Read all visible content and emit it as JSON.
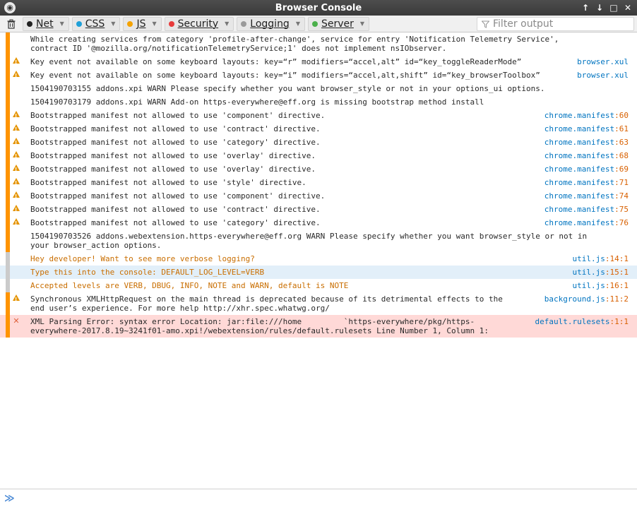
{
  "window": {
    "title": "Browser Console"
  },
  "titlebar": {
    "minimize_glyph": "↑",
    "restore_glyph": "↓",
    "max_glyph": "□",
    "close_glyph": "✕"
  },
  "toolbar": {
    "filters": [
      {
        "name": "Net",
        "color": "#222222"
      },
      {
        "name": "CSS",
        "color": "#1fa0d8"
      },
      {
        "name": "JS",
        "color": "#f5a300"
      },
      {
        "name": "Security",
        "color": "#e83b3b"
      },
      {
        "name": "Logging",
        "color": "#9a9a9a"
      },
      {
        "name": "Server",
        "color": "#4bb04b"
      }
    ],
    "filter_placeholder": "Filter output"
  },
  "messages": [
    {
      "type": "log",
      "lines": [
        "While creating services from category 'profile-after-change', service for entry 'Notification Telemetry Service',",
        "contract ID '@mozilla.org/notificationTelemetryService;1' does not implement nsIObserver."
      ],
      "source": "",
      "line": ""
    },
    {
      "type": "warn",
      "lines": [
        "Key event not available on some keyboard layouts: key=“r” modifiers=“accel,alt” id=“key_toggleReaderMode”"
      ],
      "source": "browser.xul",
      "line": ""
    },
    {
      "type": "warn",
      "lines": [
        "Key event not available on some keyboard layouts: key=“i” modifiers=“accel,alt,shift” id=“key_browserToolbox”"
      ],
      "source": "browser.xul",
      "line": ""
    },
    {
      "type": "log",
      "lines": [
        "1504190703155 addons.xpi WARN Please specify whether you want browser_style or not in your options_ui options."
      ],
      "source": "",
      "line": ""
    },
    {
      "type": "log",
      "lines": [
        "1504190703179 addons.xpi WARN Add-on https-everywhere@eff.org is missing bootstrap method install"
      ],
      "source": "",
      "line": ""
    },
    {
      "type": "warn",
      "lines": [
        "Bootstrapped manifest not allowed to use 'component' directive."
      ],
      "source": "chrome.manifest",
      "line": ":60"
    },
    {
      "type": "warn",
      "lines": [
        "Bootstrapped manifest not allowed to use 'contract' directive."
      ],
      "source": "chrome.manifest",
      "line": ":61"
    },
    {
      "type": "warn",
      "lines": [
        "Bootstrapped manifest not allowed to use 'category' directive."
      ],
      "source": "chrome.manifest",
      "line": ":63"
    },
    {
      "type": "warn",
      "lines": [
        "Bootstrapped manifest not allowed to use 'overlay' directive."
      ],
      "source": "chrome.manifest",
      "line": ":68"
    },
    {
      "type": "warn",
      "lines": [
        "Bootstrapped manifest not allowed to use 'overlay' directive."
      ],
      "source": "chrome.manifest",
      "line": ":69"
    },
    {
      "type": "warn",
      "lines": [
        "Bootstrapped manifest not allowed to use 'style' directive."
      ],
      "source": "chrome.manifest",
      "line": ":71"
    },
    {
      "type": "warn",
      "lines": [
        "Bootstrapped manifest not allowed to use 'component' directive."
      ],
      "source": "chrome.manifest",
      "line": ":74"
    },
    {
      "type": "warn",
      "lines": [
        "Bootstrapped manifest not allowed to use 'contract' directive."
      ],
      "source": "chrome.manifest",
      "line": ":75"
    },
    {
      "type": "warn",
      "lines": [
        "Bootstrapped manifest not allowed to use 'category' directive."
      ],
      "source": "chrome.manifest",
      "line": ":76"
    },
    {
      "type": "log",
      "lines": [
        "1504190703526 addons.webextension.https-everywhere@eff.org WARN Please specify whether you want browser_style or not in",
        "your browser_action options."
      ],
      "source": "",
      "line": ""
    },
    {
      "type": "logo",
      "lines": [
        "Hey developer! Want to see more verbose logging?"
      ],
      "source": "util.js",
      "line": ":14:1"
    },
    {
      "type": "logo-hl",
      "lines": [
        "Type this into the console: DEFAULT_LOG_LEVEL=VERB"
      ],
      "source": "util.js",
      "line": ":15:1"
    },
    {
      "type": "logo",
      "lines": [
        "Accepted levels are VERB, DBUG, INFO, NOTE and WARN, default is NOTE"
      ],
      "source": "util.js",
      "line": ":16:1"
    },
    {
      "type": "warn",
      "lines": [
        "Synchronous XMLHttpRequest on the main thread is deprecated because of its detrimental effects to the",
        "end user’s experience. For more help http://xhr.spec.whatwg.org/"
      ],
      "source": "background.js",
      "line": ":11:2"
    },
    {
      "type": "err",
      "lines": [
        "XML Parsing Error: syntax error Location: jar:file:///home         `https-everywhere/pkg/https-",
        "everywhere-2017.8.19~3241f01-amo.xpi!/webextension/rules/default.rulesets Line Number 1, Column 1:"
      ],
      "source": "default.rulesets",
      "line": ":1:1"
    }
  ],
  "input": {
    "prompt_glyph": "≫",
    "value": ""
  }
}
